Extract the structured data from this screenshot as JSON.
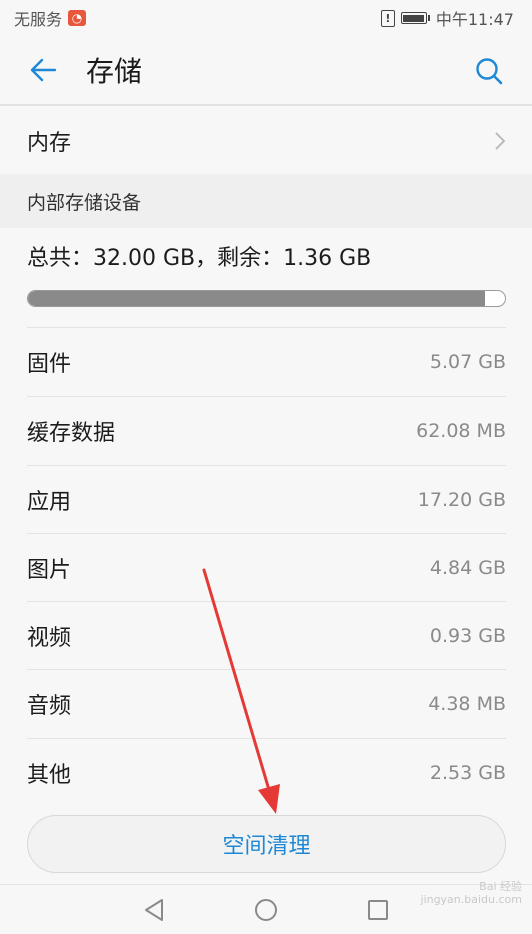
{
  "status_bar": {
    "carrier": "无服务",
    "time": "中午11:47",
    "icons": [
      "app-notification-icon",
      "alert-icon",
      "battery-icon"
    ]
  },
  "header": {
    "title": "存储",
    "back_icon": "back-arrow-icon",
    "search_icon": "search-icon"
  },
  "memory_row": {
    "label": "内存",
    "icon": "chevron-right-icon"
  },
  "internal_storage": {
    "section_title": "内部存储设备",
    "summary": "总共：32.00 GB，剩余：1.36 GB",
    "used_fraction": 0.9575
  },
  "categories": [
    {
      "label": "固件",
      "value": "5.07 GB"
    },
    {
      "label": "缓存数据",
      "value": "62.08 MB"
    },
    {
      "label": "应用",
      "value": "17.20 GB"
    },
    {
      "label": "图片",
      "value": "4.84 GB"
    },
    {
      "label": "视频",
      "value": "0.93 GB"
    },
    {
      "label": "音频",
      "value": "4.38 MB"
    },
    {
      "label": "其他",
      "value": "2.53 GB"
    }
  ],
  "clean_button": {
    "label": "空间清理"
  },
  "nav_bar": {
    "icons": [
      "back-triangle-icon",
      "home-circle-icon",
      "recents-square-icon"
    ]
  },
  "watermark": {
    "brand": "Bai 经验",
    "site": "jingyan.baidu.com"
  },
  "colors": {
    "accent": "#1e88d6",
    "annotation_arrow": "#e53935",
    "progress_fill": "#8a8a8a"
  }
}
